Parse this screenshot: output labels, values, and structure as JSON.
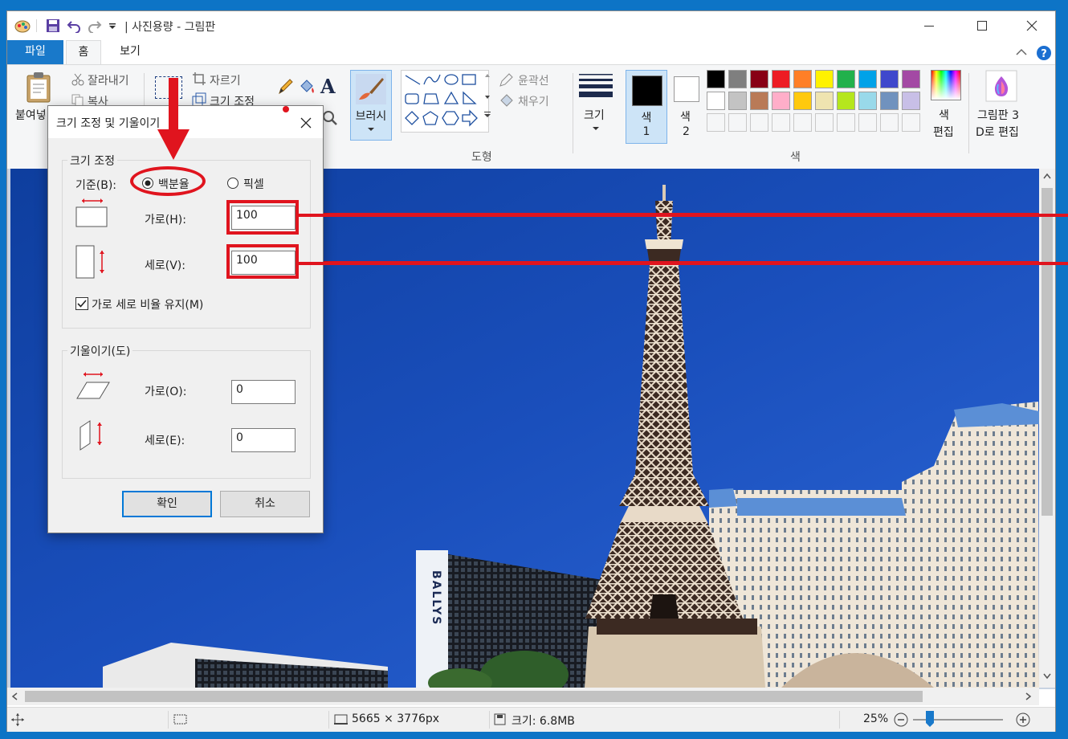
{
  "window": {
    "title": "| 사진용량 - 그림판",
    "title_buttons": [
      "minimize-icon",
      "maximize-icon",
      "close-icon"
    ]
  },
  "tabs": {
    "file": "파일",
    "home": "홈",
    "view": "보기"
  },
  "ribbon": {
    "paste": "붙여넣",
    "cut": "잘라내기",
    "copy": "복사",
    "crop": "자르기",
    "resize": "크기 조정",
    "brush": "브러시",
    "outline": "윤곽선",
    "fill": "채우기",
    "shapes_group": "도형",
    "size": "크기",
    "color1": "색",
    "color1_num": "1",
    "color2": "색",
    "color2_num": "2",
    "edit_colors_1": "색",
    "edit_colors_2": "편집",
    "paint3d_1": "그림판 3",
    "paint3d_2": "D로 편집",
    "colors_group": "색",
    "colors": {
      "current1": "#000000",
      "current2": "#ffffff",
      "palette_row1": [
        "#000000",
        "#7f7f7f",
        "#880015",
        "#ed1c24",
        "#ff7f27",
        "#fff200",
        "#22b14c",
        "#00a2e8",
        "#3f48cc",
        "#a349a4"
      ],
      "palette_row2": [
        "#ffffff",
        "#c3c3c3",
        "#b97a57",
        "#ffaec9",
        "#ffc90e",
        "#efe4b0",
        "#b5e61d",
        "#99d9ea",
        "#7092be",
        "#c8bfe7"
      ]
    }
  },
  "dialog": {
    "title": "크기 조정 및 기울이기",
    "resize_group": "크기 조정",
    "basis_label": "기준(B):",
    "percent": "백분율",
    "pixel": "픽셀",
    "horizontal_label": "가로(H):",
    "horizontal_value": "100",
    "vertical_label": "세로(V):",
    "vertical_value": "100",
    "keep_ratio": "가로 세로 비율 유지(M)",
    "skew_group": "기울이기(도)",
    "skew_h_label": "가로(O):",
    "skew_h_value": "0",
    "skew_v_label": "세로(E):",
    "skew_v_value": "0",
    "ok": "확인",
    "cancel": "취소"
  },
  "status": {
    "dimensions": "5665 × 3776px",
    "file_size": "크기: 6.8MB",
    "zoom": "25%"
  },
  "photo_text": {
    "ballys": "BALLYS"
  }
}
